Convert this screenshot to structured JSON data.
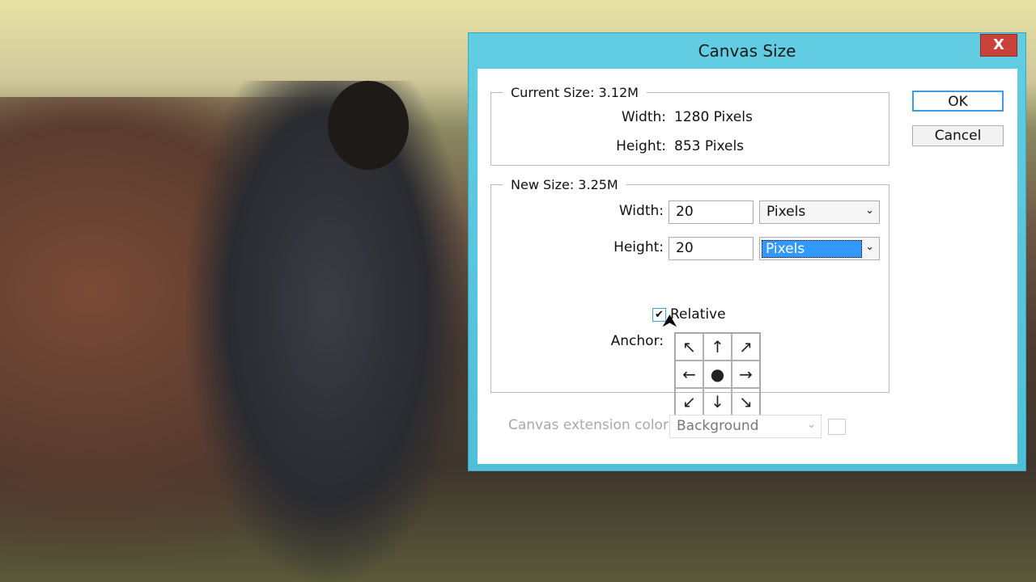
{
  "dialog": {
    "title": "Canvas Size",
    "close": "X"
  },
  "current": {
    "legend": "Current Size: 3.12M",
    "width_label": "Width:",
    "width_value": "1280 Pixels",
    "height_label": "Height:",
    "height_value": "853 Pixels"
  },
  "new_size": {
    "legend": "New Size: 3.25M",
    "width_label": "Width:",
    "width_value": "20",
    "width_unit": "Pixels",
    "height_label": "Height:",
    "height_value": "20",
    "height_unit": "Pixels",
    "relative_label": "Relative",
    "relative_checked": true,
    "anchor_label": "Anchor:",
    "anchor": [
      "↖",
      "↑",
      "↗",
      "←",
      "●",
      "→",
      "↙",
      "↓",
      "↘"
    ]
  },
  "extension": {
    "label": "Canvas extension color:",
    "value": "Background"
  },
  "buttons": {
    "ok": "OK",
    "cancel": "Cancel"
  },
  "icons": {
    "chevron": "⌄",
    "check": "✔"
  }
}
